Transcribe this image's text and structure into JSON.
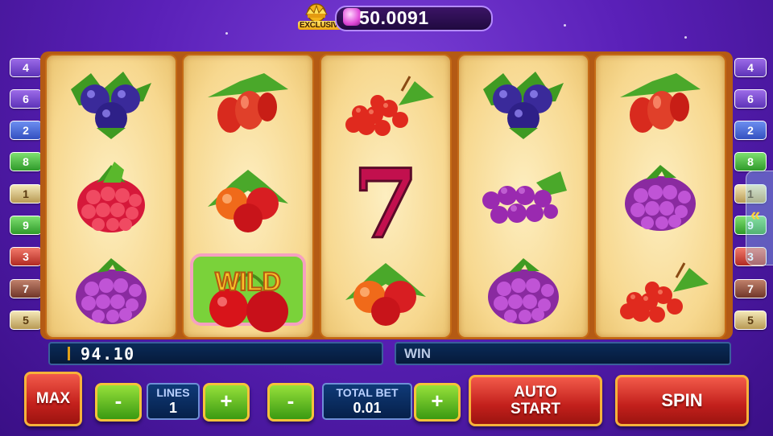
{
  "jackpot": {
    "badge": "EXCLUSIVE",
    "value": "50.0091"
  },
  "paylines": {
    "left": [
      "4",
      "6",
      "2",
      "8",
      "1",
      "9",
      "3",
      "7",
      "5"
    ],
    "right": [
      "4",
      "6",
      "2",
      "8",
      "1",
      "9",
      "3",
      "7",
      "5"
    ],
    "colors": [
      "purple",
      "purple",
      "blue",
      "green",
      "cream",
      "green",
      "red",
      "brown",
      "cream"
    ]
  },
  "reels": [
    {
      "symbols": [
        "blueberry",
        "raspberry",
        "blackberry"
      ]
    },
    {
      "symbols": [
        "goji-berry",
        "cranberry",
        "wild-cherry"
      ]
    },
    {
      "symbols": [
        "redcurrant",
        "seven",
        "cranberry"
      ]
    },
    {
      "symbols": [
        "blueberry",
        "grapes",
        "blackberry"
      ]
    },
    {
      "symbols": [
        "goji-berry",
        "blackberry",
        "redcurrant"
      ]
    }
  ],
  "wild_label": "WILD",
  "seven_label": "7",
  "credit": "94.10",
  "win": {
    "label": "WIN",
    "value": ""
  },
  "controls": {
    "max_label": "MAX",
    "minus_label": "-",
    "plus_label": "+",
    "lines_label": "LINES",
    "lines_value": "1",
    "total_bet_label": "TOTAL BET",
    "total_bet_value": "0.01",
    "auto_start_line1": "AUTO",
    "auto_start_line2": "START",
    "spin_label": "SPIN"
  },
  "side_arrow": "«",
  "colors": {
    "background": "#5a20b8",
    "reel_face": "#f7d88f",
    "reel_frame": "#b45a14",
    "button_red": "#c3201c",
    "button_green": "#3a9a12",
    "gold_border": "#f7b23a"
  }
}
